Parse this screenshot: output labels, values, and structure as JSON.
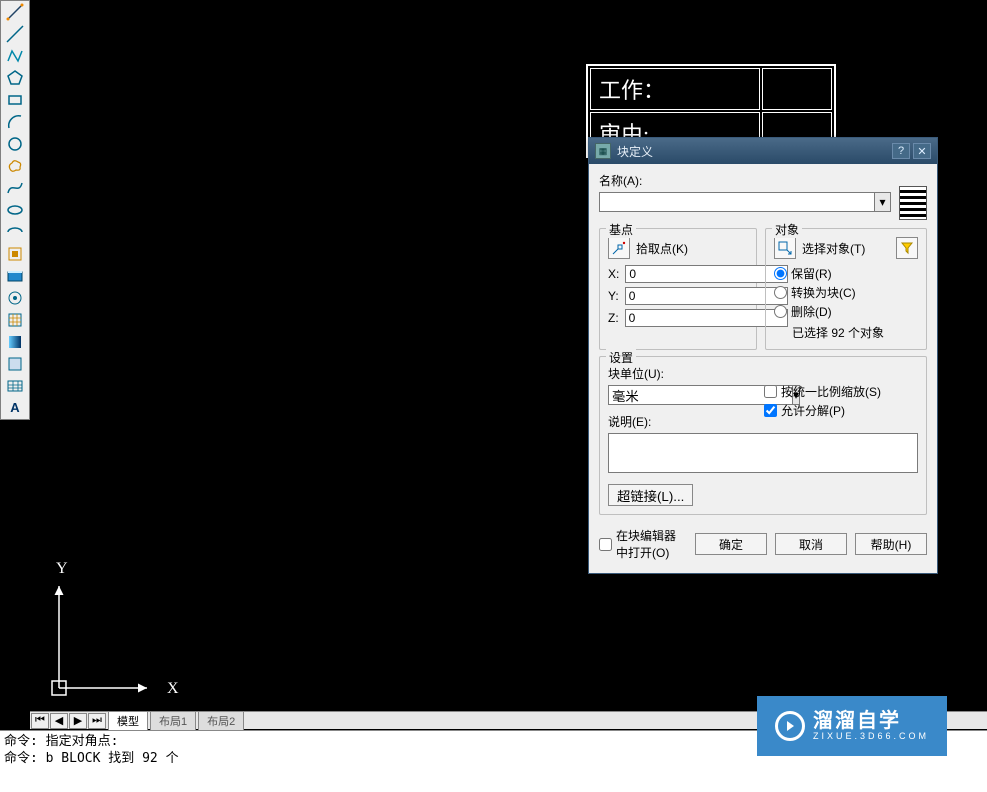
{
  "bg_table": {
    "work_label": "工作：",
    "by_label": "审由:"
  },
  "ucs": {
    "x": "X",
    "y": "Y"
  },
  "tabs": {
    "model": "模型",
    "layout1": "布局1",
    "layout2": "布局2"
  },
  "cmd": {
    "line1": "命令: 指定对角点:",
    "line2": "命令: b BLOCK 找到 92 个"
  },
  "dialog": {
    "title": "块定义",
    "name_label": "名称(A):",
    "name_value": "",
    "group_base": "基点",
    "pick_point": "拾取点(K)",
    "x_label": "X:",
    "x_value": "0",
    "y_label": "Y:",
    "y_value": "0",
    "z_label": "Z:",
    "z_value": "0",
    "group_obj": "对象",
    "select_obj": "选择对象(T)",
    "opt_retain": "保留(R)",
    "opt_convert": "转换为块(C)",
    "opt_delete": "删除(D)",
    "selected_count": "已选择 92 个对象",
    "group_settings": "设置",
    "unit_label": "块单位(U):",
    "unit_value": "毫米",
    "scale_uniform": "按统一比例缩放(S)",
    "allow_explode": "允许分解(P)",
    "desc_label": "说明(E):",
    "desc_value": "",
    "hyperlink": "超链接(L)...",
    "open_editor": "在块编辑器中打开(O)",
    "ok": "确定",
    "cancel": "取消",
    "help": "帮助(H)"
  },
  "watermark": {
    "brand": "溜溜自学",
    "sub": "ZIXUE.3D66.COM"
  }
}
